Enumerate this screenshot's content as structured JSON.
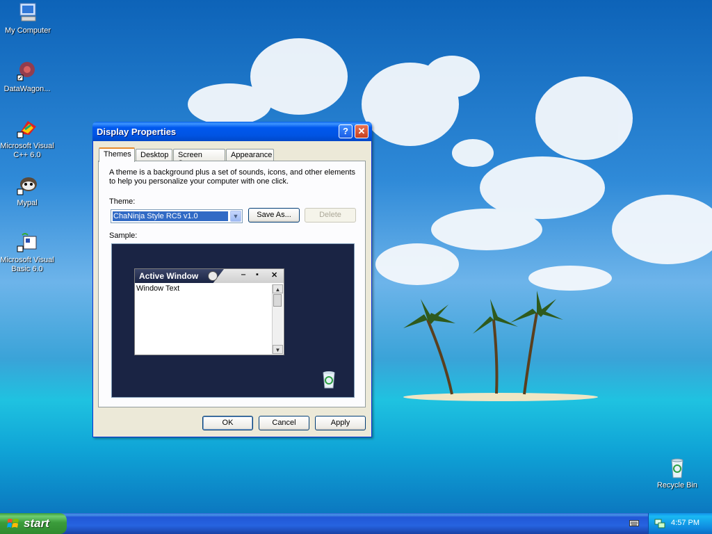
{
  "desktop": {
    "icons": [
      {
        "label": "My Computer",
        "icon": "my-computer-icon"
      },
      {
        "label": "DataWagon...",
        "icon": "datawagon-icon"
      },
      {
        "label": "Microsoft Visual C++ 6.0",
        "icon": "visual-cpp-icon"
      },
      {
        "label": "Mypal",
        "icon": "mypal-icon"
      },
      {
        "label": "Microsoft Visual Basic 6.0",
        "icon": "visual-basic-icon"
      },
      {
        "label": "Recycle Bin",
        "icon": "recycle-bin-icon"
      }
    ]
  },
  "dialog": {
    "title": "Display Properties",
    "help_glyph": "?",
    "close_glyph": "✕",
    "tabs": [
      {
        "label": "Themes"
      },
      {
        "label": "Desktop"
      },
      {
        "label": "Screen Saver"
      },
      {
        "label": "Appearance"
      }
    ],
    "description": "A theme is a background plus a set of sounds, icons, and other elements to help you personalize your computer with one click.",
    "theme_label": "Theme:",
    "theme_value": "ChaNinja Style RC5 v1.0",
    "save_as_label": "Save As...",
    "delete_label": "Delete",
    "sample_label": "Sample:",
    "sample": {
      "window_title": "Active Window",
      "window_text": "Window Text"
    },
    "ok_label": "OK",
    "cancel_label": "Cancel",
    "apply_label": "Apply"
  },
  "taskbar": {
    "start_label": "start",
    "clock": "4:57 PM"
  },
  "colors": {
    "title_blue": "#0054e3",
    "taskbar_blue": "#2663e0",
    "start_green": "#3b9c3b",
    "sample_bg": "#1a2444"
  }
}
